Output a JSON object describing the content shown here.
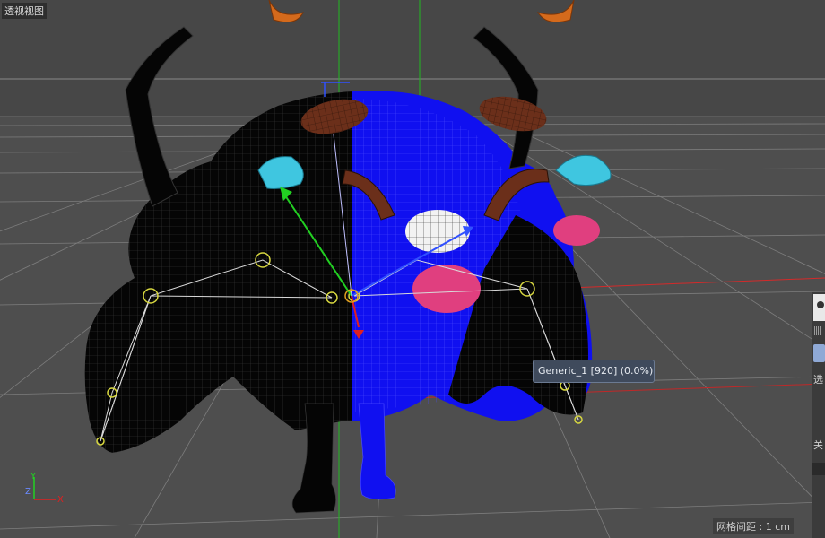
{
  "viewport": {
    "title": "透视视图",
    "grid_spacing_label": "网格间距 : 1 cm"
  },
  "tooltip": {
    "text": "Generic_1 [920] (0.0%)"
  },
  "axis_indicator": {
    "y": "Y",
    "z": "Z",
    "x": "X"
  },
  "side_panel": {
    "label_select": "选",
    "label_keyframe": "关"
  },
  "colors": {
    "background": "#4b4b4b",
    "body_black": "#050505",
    "body_blue": "#1010f0",
    "horn_brown": "#6b2f1a",
    "eye_cyan": "#3fc6e0",
    "cheek_pink": "#e03f7f",
    "nose_white": "#f2f2f2",
    "y_axis": "#22d022",
    "x_axis": "#e02020",
    "z_axis": "#3050ff"
  }
}
